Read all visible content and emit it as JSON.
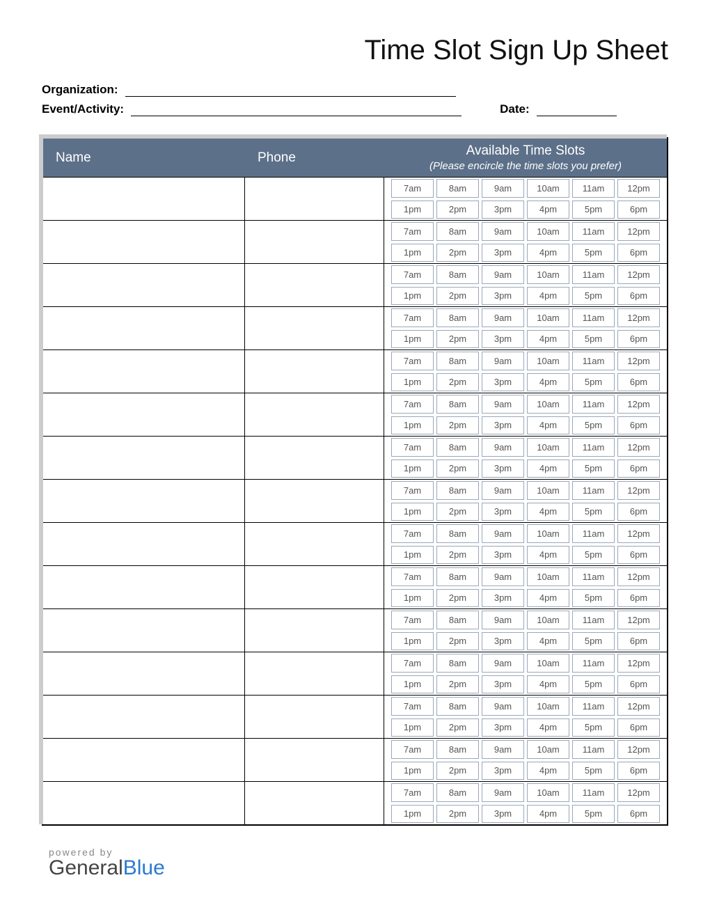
{
  "title": "Time Slot Sign Up Sheet",
  "meta": {
    "org_label": "Organization:",
    "event_label": "Event/Activity:",
    "date_label": "Date:"
  },
  "header": {
    "name": "Name",
    "phone": "Phone",
    "slots_title": "Available Time Slots",
    "slots_sub": "(Please encircle the time slots you prefer)"
  },
  "time_slots": {
    "row1": [
      "7am",
      "8am",
      "9am",
      "10am",
      "11am",
      "12pm"
    ],
    "row2": [
      "1pm",
      "2pm",
      "3pm",
      "4pm",
      "5pm",
      "6pm"
    ]
  },
  "row_count": 15,
  "footer": {
    "powered": "powered by",
    "brand1": "General",
    "brand2": "Blue"
  }
}
